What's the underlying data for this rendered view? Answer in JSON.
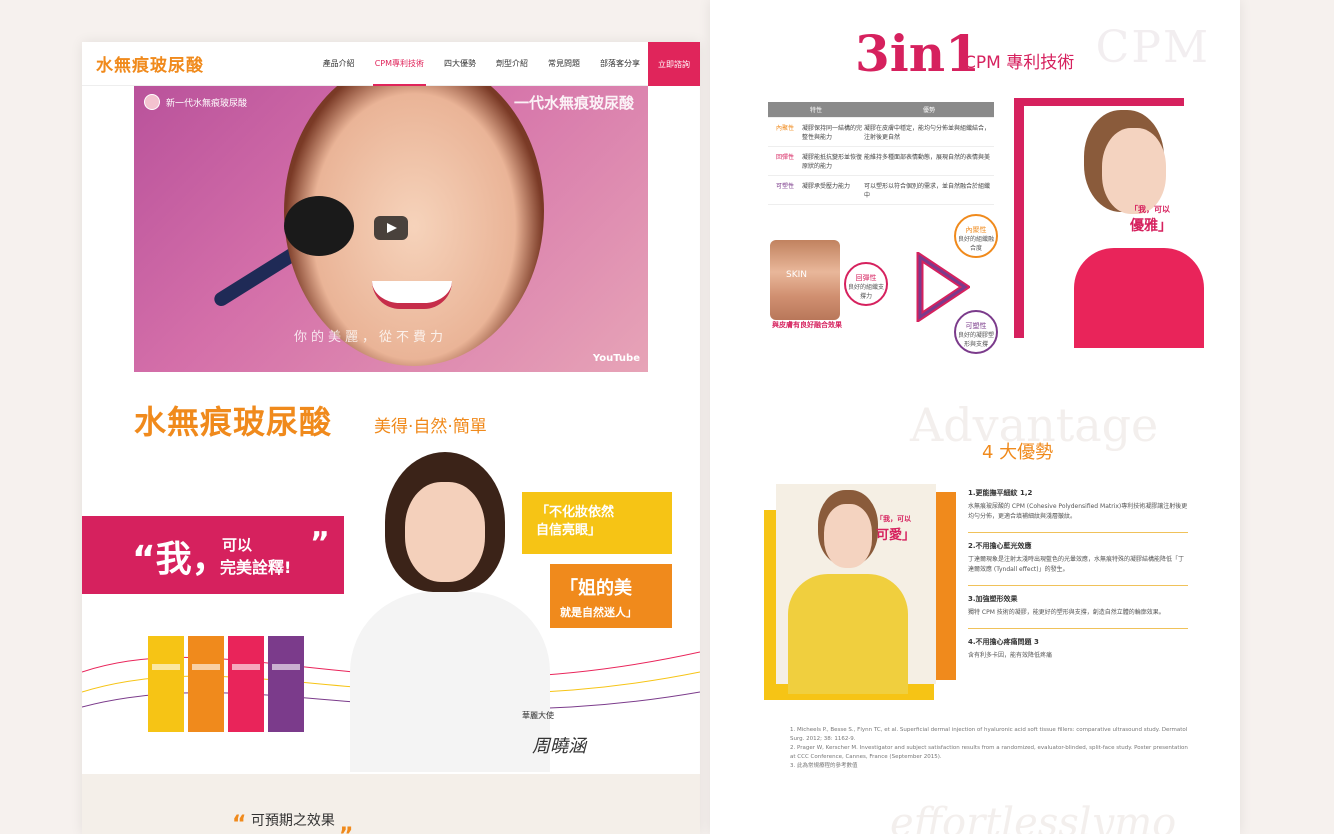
{
  "left": {
    "logo": "水無痕玻尿酸",
    "nav": [
      "產品介紹",
      "CPM專利技術",
      "四大優勢",
      "劑型介紹",
      "常見問題",
      "部落客分享"
    ],
    "cta": "立即諮詢",
    "video": {
      "title": "新一代水無痕玻尿酸",
      "brand_overlay": "一代水無痕玻尿酸",
      "caption": "你的美麗，從不費力",
      "platform": "YouTube"
    },
    "headline": "水無痕玻尿酸",
    "subline": "美得‧自然‧簡單",
    "quote_mark": "“我，",
    "quote_line1": "可以",
    "quote_line2": "完美詮釋!",
    "quote_close": "”",
    "yellow_line1": "「不化妝依然",
    "yellow_line2": "自信亮眼」",
    "orange_line1": "「姐的美",
    "orange_line2": "就是自然迷人」",
    "sig_label": "華麗大使",
    "sig_name": "周曉涵",
    "expect_open": "“",
    "expect_label": "可預期之效果",
    "expect_close": "„",
    "box_colors": [
      "#f6c415",
      "#f08a1c",
      "#e9245a",
      "#7b3b8b"
    ]
  },
  "right": {
    "bg_word": "CPM",
    "tri_label_big": "3in1",
    "tri_label": "CPM 專利技術",
    "table": {
      "headers": [
        "特性",
        "優勢"
      ],
      "rows": [
        {
          "k": "內聚性",
          "v": "凝膠保持同一結構的完整性與能力",
          "d": "凝膠在皮膚中穩定，能均勻分佈並與組織結合，注射後更自然"
        },
        {
          "k": "回彈性",
          "v": "凝膠能抵抗變形並恢復原狀的能力",
          "d": "能維持多種面部表情動態，展現自然的表情與美"
        },
        {
          "k": "可塑性",
          "v": "凝膠承受壓力能力",
          "d": "可以塑形以符合個別的需求，並自然融合於組織中"
        }
      ]
    },
    "skin_word": "SKIN",
    "skin_label": "與皮膚有良好融合效果",
    "circles": [
      {
        "t": "內聚性",
        "s": "良好的組織融合度"
      },
      {
        "t": "回彈性",
        "s": "良好的組織支撐力"
      },
      {
        "t": "可塑性",
        "s": "良好的凝膠塑形與支撐"
      }
    ],
    "tag1_a": "「我，可以",
    "tag1_b": "優雅」",
    "adv_bg": "Advantage",
    "adv_title": "4 大優勢",
    "tag2_a": "「我，可以",
    "tag2_b": "可愛」",
    "advantages": [
      {
        "t": "1.更能撫平細紋 1,2",
        "d": "水無痕玻尿酸的 CPM (Cohesive Polydensified Matrix)專利技術凝膠讓注射後更均勻分佈，更適合填補細紋與淺層皺紋。"
      },
      {
        "t": "2.不用擔心藍光效應",
        "d": "丁達爾現象是注射太淺時出現藍色的光暈效應，水無痕特殊的凝膠結構能降低「丁達爾效應 (Tyndall effect)」的發生。"
      },
      {
        "t": "3.加強塑形效果",
        "d": "獨特 CPM 技術的凝膠，能更好的塑形與支撐，創造自然立體的輪廓效果。"
      },
      {
        "t": "4.不用擔心疼痛問題 3",
        "d": "含有利多卡因，能有效降低疼痛"
      }
    ],
    "refs": [
      "1. Micheels P., Besse S., Flynn TC, et al. Superficial dermal injection of hyaluronic acid soft tissue fillers: comparative ultrasound study. Dermatol Surg. 2012; 38: 1162-9.",
      "2. Prager W, Kerscher M. Investigator and subject satisfaction results from a randomized, evaluator-blinded, split-face study. Poster presentation at CCC Conference, Cannes, France (September 2015).",
      "3. 此為常規療程的參考數值"
    ],
    "eff_bg": "effortlesslymo"
  }
}
